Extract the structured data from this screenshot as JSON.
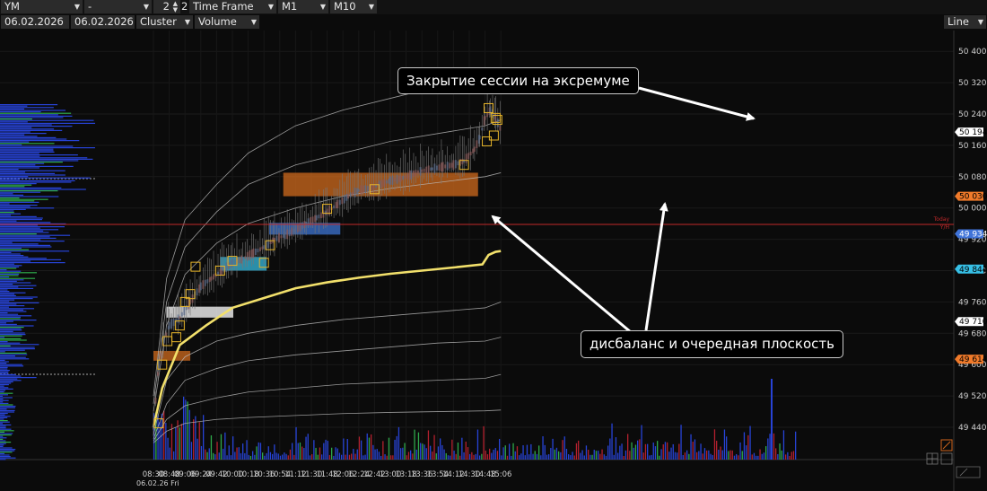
{
  "toolbar": {
    "symbol": "YM",
    "symbol_sub": "-",
    "count": "2",
    "count_suffix": "2",
    "mode": "Time Frame",
    "tf1": "M1",
    "tf2": "M10",
    "date_from": "06.02.2026",
    "date_to": "06.02.2026",
    "chart_kind": "Cluster",
    "metric": "Volume",
    "line_mode": "Line"
  },
  "annotations": {
    "top": "Закрытие сессии на эксремуме",
    "bottom": "дисбаланс и очередная плоскость"
  },
  "colors": {
    "background": "#0b0b0b",
    "vwap": "#f2e06b",
    "bands": "#bdbdbd",
    "zone_orange": "#c8661c",
    "zone_blue": "#3b6fc9",
    "zone_cyan": "#35b4d6",
    "zone_white": "#e6e6e6",
    "red_line": "#c0282a"
  },
  "chart_data": {
    "type": "line",
    "x_labels": [
      "08:30",
      "08:48",
      "09:06",
      "09:24",
      "09:42",
      "10:00",
      "10:18",
      "10:36",
      "10:54",
      "11:12",
      "11:30",
      "11:48",
      "12:06",
      "12:24",
      "12:42",
      "13:00",
      "13:18",
      "13:36",
      "13:54",
      "14:12",
      "14:30",
      "14:48",
      "15:06"
    ],
    "x_date_label": "06.02.26 Fri",
    "y_ticks": [
      50400,
      50320,
      50240,
      50160,
      50080,
      50000,
      49920,
      49840,
      49760,
      49680,
      49600,
      49520,
      49440
    ],
    "y_tick_labels": [
      "50 400",
      "50 320",
      "50 240",
      "50 160",
      "50 080",
      "50 000",
      "49 920",
      "49 840",
      "49 760",
      "49 680",
      "49 600",
      "49 520",
      "49 440"
    ],
    "ylim": [
      49400,
      50440
    ],
    "grid": true,
    "price_badges": [
      {
        "value": 50194,
        "label": "50 194",
        "color": "#ffffff",
        "text_color": "#000000"
      },
      {
        "value": 50030,
        "label": "50 030",
        "color": "#f07a2a",
        "text_color": "#000000"
      },
      {
        "value": 49934,
        "label": "49 934",
        "color": "#3f73d8",
        "text_color": "#ffffff"
      },
      {
        "value": 49844,
        "label": "49 844",
        "color": "#37c0e6",
        "text_color": "#000000"
      },
      {
        "value": 49710,
        "label": "49 710",
        "color": "#ffffff",
        "text_color": "#000000"
      },
      {
        "value": 49614,
        "label": "49 614",
        "color": "#f07a2a",
        "text_color": "#000000"
      }
    ],
    "red_line": {
      "value": 49958,
      "label": "Today",
      "sub_label": "Y/H"
    },
    "zones": [
      {
        "name": "orange-small",
        "t0": "08:30",
        "t1": "09:12",
        "p0": 49610,
        "p1": 49635,
        "color": "#c8661c"
      },
      {
        "name": "white",
        "t0": "08:45",
        "t1": "10:01",
        "p0": 49720,
        "p1": 49748,
        "color": "#e6e6e6"
      },
      {
        "name": "cyan",
        "t0": "09:46",
        "t1": "10:39",
        "p0": 49840,
        "p1": 49875,
        "color": "#35b4d6"
      },
      {
        "name": "blue",
        "t0": "10:42",
        "t1": "12:03",
        "p0": 49932,
        "p1": 49962,
        "color": "#3b6fc9"
      },
      {
        "name": "orange-large",
        "t0": "10:58",
        "t1": "14:40",
        "p0": 50030,
        "p1": 50090,
        "color": "#c8661c"
      }
    ],
    "series": [
      {
        "name": "VWAP",
        "x": [
          "08:30",
          "08:40",
          "09:00",
          "09:30",
          "10:00",
          "10:36",
          "11:12",
          "11:48",
          "12:24",
          "13:00",
          "13:36",
          "14:12",
          "14:45",
          "14:52",
          "15:00",
          "15:06"
        ],
        "y": [
          49440,
          49540,
          49650,
          49700,
          49745,
          49770,
          49795,
          49810,
          49822,
          49832,
          49840,
          49848,
          49856,
          49880,
          49888,
          49890
        ]
      },
      {
        "name": "band-u1",
        "x": [
          "08:30",
          "08:45",
          "09:06",
          "09:42",
          "10:18",
          "11:12",
          "12:06",
          "13:00",
          "13:54",
          "14:48",
          "15:06"
        ],
        "y": [
          49480,
          49700,
          49830,
          49910,
          49960,
          50000,
          50030,
          50050,
          50065,
          50080,
          50090
        ]
      },
      {
        "name": "band-u2",
        "x": [
          "08:30",
          "08:45",
          "09:06",
          "09:42",
          "10:18",
          "11:12",
          "12:06",
          "13:00",
          "13:54",
          "14:48",
          "15:06"
        ],
        "y": [
          49500,
          49760,
          49900,
          49990,
          50060,
          50110,
          50140,
          50170,
          50190,
          50210,
          50225
        ]
      },
      {
        "name": "band-u3",
        "x": [
          "08:30",
          "08:45",
          "09:06",
          "09:42",
          "10:18",
          "11:12",
          "12:06",
          "13:00",
          "13:54",
          "14:48",
          "15:06"
        ],
        "y": [
          49520,
          49820,
          49970,
          50060,
          50140,
          50210,
          50250,
          50280,
          50310,
          50330,
          50340
        ]
      },
      {
        "name": "band-l1",
        "x": [
          "08:30",
          "08:45",
          "09:06",
          "09:42",
          "10:18",
          "11:12",
          "12:06",
          "13:00",
          "13:54",
          "14:48",
          "15:06"
        ],
        "y": [
          49420,
          49560,
          49620,
          49660,
          49680,
          49700,
          49715,
          49725,
          49735,
          49745,
          49760
        ]
      },
      {
        "name": "band-l2",
        "x": [
          "08:30",
          "08:45",
          "09:06",
          "09:42",
          "10:18",
          "11:12",
          "12:06",
          "13:00",
          "13:54",
          "14:48",
          "15:06"
        ],
        "y": [
          49410,
          49500,
          49560,
          49590,
          49610,
          49625,
          49635,
          49645,
          49655,
          49660,
          49670
        ]
      },
      {
        "name": "band-l3",
        "x": [
          "08:30",
          "08:45",
          "09:06",
          "09:42",
          "10:18",
          "11:12",
          "12:06",
          "13:00",
          "13:54",
          "14:48",
          "15:06"
        ],
        "y": [
          49405,
          49460,
          49495,
          49515,
          49530,
          49540,
          49550,
          49555,
          49560,
          49565,
          49575
        ]
      },
      {
        "name": "band-l4",
        "x": [
          "08:30",
          "08:45",
          "09:06",
          "09:42",
          "10:18",
          "11:12",
          "12:06",
          "13:00",
          "13:54",
          "14:48",
          "15:06"
        ],
        "y": [
          49400,
          49430,
          49450,
          49460,
          49465,
          49470,
          49475,
          49478,
          49480,
          49482,
          49484
        ]
      }
    ],
    "price_path": {
      "x": [
        "08:30",
        "08:36",
        "08:42",
        "08:48",
        "09:00",
        "09:12",
        "09:24",
        "09:36",
        "09:48",
        "10:00",
        "10:12",
        "10:24",
        "10:36",
        "10:48",
        "11:00",
        "11:12",
        "11:24",
        "11:36",
        "11:48",
        "12:00",
        "12:12",
        "12:24",
        "12:36",
        "12:48",
        "13:00",
        "13:12",
        "13:24",
        "13:36",
        "13:48",
        "14:00",
        "14:12",
        "14:24",
        "14:36",
        "14:42",
        "14:48",
        "14:54",
        "15:00",
        "15:06"
      ],
      "y": [
        49440,
        49600,
        49660,
        49700,
        49720,
        49760,
        49800,
        49820,
        49840,
        49860,
        49870,
        49885,
        49900,
        49920,
        49930,
        49945,
        49960,
        49975,
        49990,
        50010,
        50030,
        50045,
        50050,
        50060,
        50070,
        50075,
        50085,
        50095,
        50100,
        50105,
        50110,
        50120,
        50150,
        50180,
        50230,
        50250,
        50230,
        50200
      ]
    },
    "marker_boxes": [
      {
        "t": "08:36",
        "p": 49450
      },
      {
        "t": "08:40",
        "p": 49600
      },
      {
        "t": "08:46",
        "p": 49660
      },
      {
        "t": "08:56",
        "p": 49670
      },
      {
        "t": "09:00",
        "p": 49700
      },
      {
        "t": "09:06",
        "p": 49760
      },
      {
        "t": "09:12",
        "p": 49780
      },
      {
        "t": "09:18",
        "p": 49850
      },
      {
        "t": "09:46",
        "p": 49840
      },
      {
        "t": "10:00",
        "p": 49865
      },
      {
        "t": "10:36",
        "p": 49860
      },
      {
        "t": "10:43",
        "p": 49905
      },
      {
        "t": "11:48",
        "p": 49998
      },
      {
        "t": "12:42",
        "p": 50048
      },
      {
        "t": "14:24",
        "p": 50110
      },
      {
        "t": "14:50",
        "p": 50170
      },
      {
        "t": "14:58",
        "p": 50185
      },
      {
        "t": "15:00",
        "p": 50230
      },
      {
        "t": "14:52",
        "p": 50255
      },
      {
        "t": "15:02",
        "p": 50225
      }
    ]
  }
}
